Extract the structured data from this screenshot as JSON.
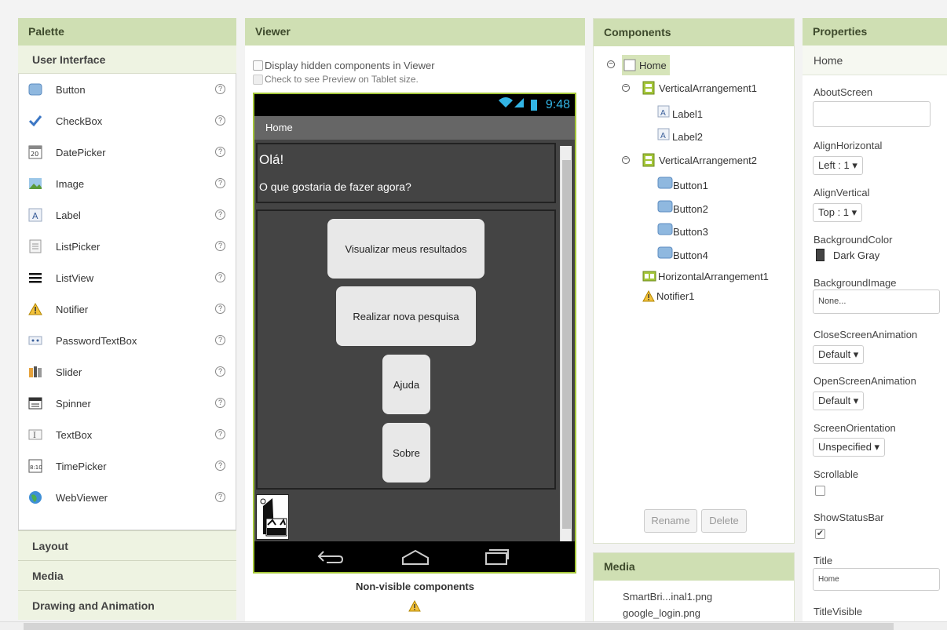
{
  "palette": {
    "title": "Palette",
    "group": "User Interface",
    "items": [
      {
        "label": "Button",
        "icon": "button-icon"
      },
      {
        "label": "CheckBox",
        "icon": "checkbox-icon"
      },
      {
        "label": "DatePicker",
        "icon": "datepicker-icon"
      },
      {
        "label": "Image",
        "icon": "image-icon"
      },
      {
        "label": "Label",
        "icon": "label-icon"
      },
      {
        "label": "ListPicker",
        "icon": "listpicker-icon"
      },
      {
        "label": "ListView",
        "icon": "listview-icon"
      },
      {
        "label": "Notifier",
        "icon": "notifier-icon"
      },
      {
        "label": "PasswordTextBox",
        "icon": "passwordtextbox-icon"
      },
      {
        "label": "Slider",
        "icon": "slider-icon"
      },
      {
        "label": "Spinner",
        "icon": "spinner-icon"
      },
      {
        "label": "TextBox",
        "icon": "textbox-icon"
      },
      {
        "label": "TimePicker",
        "icon": "timepicker-icon"
      },
      {
        "label": "WebViewer",
        "icon": "webviewer-icon"
      }
    ],
    "help": "?",
    "sections": [
      "Layout",
      "Media",
      "Drawing and Animation"
    ]
  },
  "viewer": {
    "title": "Viewer",
    "check_hidden": "Display hidden components in Viewer",
    "check_tablet": "Check to see Preview on Tablet size.",
    "phone": {
      "time": "9:48",
      "screen_title": "Home",
      "greeting": "Olá!",
      "question": "O que gostaria de fazer agora?",
      "buttons": [
        "Visualizar meus resultados",
        "Realizar nova pesquisa",
        "Ajuda",
        "Sobre"
      ]
    },
    "nonvisible_label": "Non-visible components"
  },
  "components": {
    "title": "Components",
    "tree": [
      "Home",
      "VerticalArrangement1",
      "Label1",
      "Label2",
      "VerticalArrangement2",
      "Button1",
      "Button2",
      "Button3",
      "Button4",
      "HorizontalArrangement1",
      "Notifier1"
    ],
    "rename": "Rename",
    "delete": "Delete"
  },
  "media": {
    "title": "Media",
    "files": [
      "SmartBri...inal1.png",
      "google_login.png"
    ]
  },
  "properties": {
    "title": "Properties",
    "component": "Home",
    "about_label": "AboutScreen",
    "align_h_label": "AlignHorizontal",
    "align_h_value": "Left : 1 ▾",
    "align_v_label": "AlignVertical",
    "align_v_value": "Top : 1 ▾",
    "bgcolor_label": "BackgroundColor",
    "bgcolor_value": "Dark Gray",
    "bgcolor_swatch": "#444444",
    "bgimage_label": "BackgroundImage",
    "bgimage_value": "None...",
    "close_anim_label": "CloseScreenAnimation",
    "close_anim_value": "Default ▾",
    "open_anim_label": "OpenScreenAnimation",
    "open_anim_value": "Default ▾",
    "orientation_label": "ScreenOrientation",
    "orientation_value": "Unspecified ▾",
    "scrollable_label": "Scrollable",
    "statusbar_label": "ShowStatusBar",
    "title_label": "Title",
    "title_value": "Home",
    "titlevisible_label": "TitleVisible"
  },
  "colors": {
    "header": "#cfdfb3",
    "phone_border": "#a4c639",
    "phone_bg": "#444444"
  }
}
